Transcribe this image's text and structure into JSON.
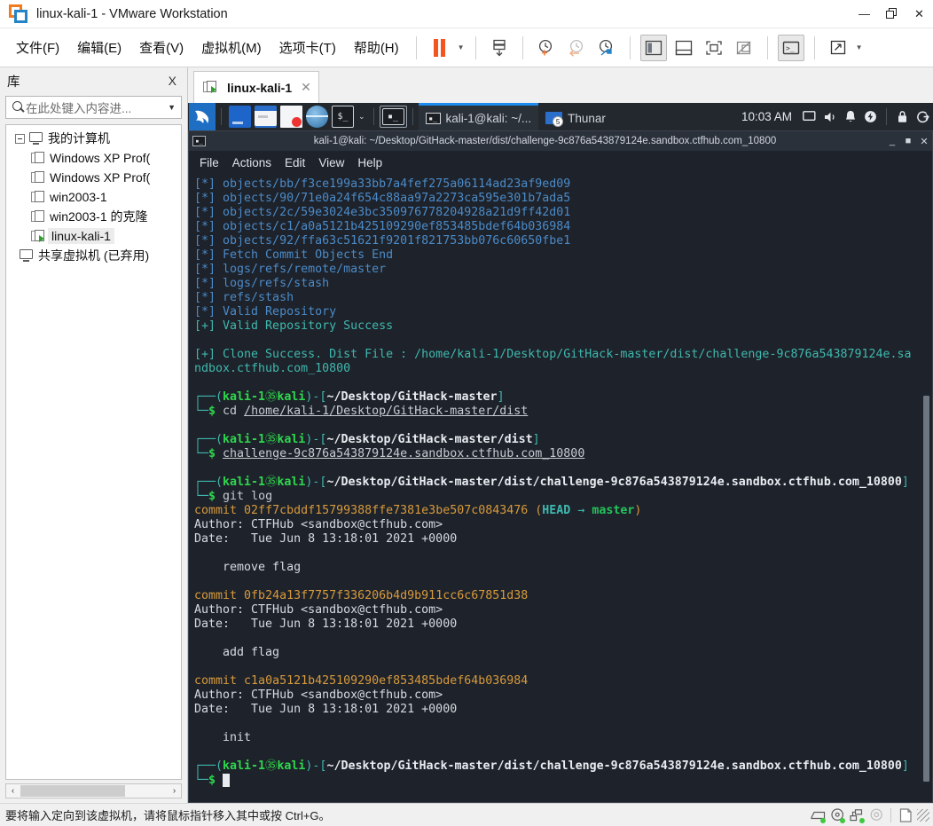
{
  "window": {
    "title": "linux-kali-1 - VMware Workstation",
    "logo_icon": "vmware-logo-icon",
    "controls": {
      "minimize": "—",
      "restore": "❐",
      "close": "✕"
    }
  },
  "menubar": {
    "items": [
      {
        "label": "文件(F)",
        "accel": "F",
        "name": "menu-file"
      },
      {
        "label": "编辑(E)",
        "accel": "E",
        "name": "menu-edit"
      },
      {
        "label": "查看(V)",
        "accel": "V",
        "name": "menu-view"
      },
      {
        "label": "虚拟机(M)",
        "accel": "M",
        "name": "menu-vm"
      },
      {
        "label": "选项卡(T)",
        "accel": "T",
        "name": "menu-tabs"
      },
      {
        "label": "帮助(H)",
        "accel": "H",
        "name": "menu-help"
      }
    ],
    "toolbar_icons": [
      "pause-icon",
      "dropdown-caret-icon",
      "snapshot-icon",
      "take-snapshot-icon",
      "revert-snapshot-icon",
      "snapshot-manager-icon",
      "show-library-icon",
      "show-thumbnails-icon",
      "fullscreen-icon",
      "unity-mode-icon",
      "console-view-icon",
      "stretch-guest-icon"
    ],
    "accent_orange": "#f4541d"
  },
  "sidebar": {
    "title": "库",
    "close_label": "X",
    "search": {
      "placeholder": "在此处键入内容进...",
      "value": "",
      "icon": "search-icon",
      "caret": "▼"
    },
    "tree": {
      "root": {
        "label": "我的计算机",
        "icon": "computer-icon",
        "expanded": true
      },
      "items": [
        {
          "label": "Windows XP Prof(",
          "icon": "vm-icon",
          "selected": false,
          "clone": false
        },
        {
          "label": "Windows XP Prof(",
          "icon": "vm-clone-icon",
          "selected": false,
          "clone": true
        },
        {
          "label": "win2003-1",
          "icon": "vm-icon",
          "selected": false,
          "clone": false
        },
        {
          "label": "win2003-1 的克隆",
          "icon": "vm-clone-icon",
          "selected": false,
          "clone": true
        },
        {
          "label": "linux-kali-1",
          "icon": "vm-running-icon",
          "selected": true,
          "clone": false,
          "running": true
        }
      ],
      "shared": {
        "label": "共享虚拟机 (已弃用)",
        "icon": "shared-vm-icon"
      }
    },
    "hscrollbar": {
      "left_arrow": "‹",
      "right_arrow": "›"
    }
  },
  "tabs": [
    {
      "label": "linux-kali-1",
      "icon": "vm-running-icon",
      "close": "✕",
      "active": true
    }
  ],
  "guest": {
    "panel": {
      "menu_icon": "kali-dragon-icon",
      "launchers": [
        "show-desktop-icon",
        "file-manager-icon",
        "text-editor-icon",
        "web-browser-icon",
        "terminal-icon"
      ],
      "launcher_caret": "⌄",
      "active_launcher": "terminal-icon",
      "tasks": [
        {
          "label": "kali-1@kali: ~/...",
          "icon": "terminal-icon",
          "active": true
        },
        {
          "label": "Thunar",
          "icon": "folder-icon",
          "badge": "5",
          "active": false
        }
      ],
      "clock": "10:03 AM",
      "tray_icons": [
        "display-icon",
        "volume-icon",
        "notification-bell-icon",
        "power-icon",
        "lock-icon",
        "logout-icon"
      ]
    },
    "terminal": {
      "icon": "terminal-icon",
      "title": "kali-1@kali: ~/Desktop/GitHack-master/dist/challenge-9c876a543879124e.sandbox.ctfhub.com_10800",
      "controls": {
        "minimize": "_",
        "maximize": "■",
        "close": "✕"
      },
      "menu": [
        "File",
        "Actions",
        "Edit",
        "View",
        "Help"
      ],
      "colors": {
        "background": "#1e222a",
        "blue": "#4b8bc8",
        "cyan": "#3fb8af",
        "green": "#2fd64f",
        "yellow": "#d79a3c",
        "foreground": "#d6dbe1"
      },
      "gitfetch_lines": [
        "[*] objects/bb/f3ce199a33bb7a4fef275a06114ad23af9ed09",
        "[*] objects/90/71e0a24f654c88aa97a2273ca595e301b7ada5",
        "[*] objects/2c/59e3024e3bc350976778204928a21d9ff42d01",
        "[*] objects/c1/a0a5121b425109290ef853485bdef64b036984",
        "[*] objects/92/ffa63c51621f9201f821753bb076c60650fbe1",
        "[*] Fetch Commit Objects End",
        "[*] logs/refs/remote/master",
        "[*] logs/refs/stash",
        "[*] refs/stash",
        "[*] Valid Repository"
      ],
      "success_line": "[+] Valid Repository Success",
      "clone_line_1": "[+] Clone Success. Dist File : /home/kali-1/Desktop/GitHack-master/dist/challenge-9c876a543879124e.sa",
      "clone_line_2": "ndbox.ctfhub.com_10800",
      "prompts": [
        {
          "user": "kali-1",
          "host": "kali",
          "sep": "㉟",
          "path": "~/Desktop/GitHack-master",
          "command": "cd ",
          "argument": "/home/kali-1/Desktop/GitHack-master/dist"
        },
        {
          "user": "kali-1",
          "host": "kali",
          "sep": "㉟",
          "path": "~/Desktop/GitHack-master/dist",
          "command": "",
          "argument": "challenge-9c876a543879124e.sandbox.ctfhub.com_10800"
        },
        {
          "user": "kali-1",
          "host": "kali",
          "sep": "㉟",
          "path": "~/Desktop/GitHack-master/dist/challenge-9c876a543879124e.sandbox.ctfhub.com_10800",
          "command": "git log",
          "argument": ""
        },
        {
          "user": "kali-1",
          "host": "kali",
          "sep": "㉟",
          "path": "~/Desktop/GitHack-master/dist/challenge-9c876a543879124e.sandbox.ctfhub.com_10800",
          "command": "",
          "argument": "",
          "cursor": true
        }
      ],
      "git_log": [
        {
          "commit_word": "commit ",
          "hash": "02ff7cbddf15799388ffe7381e3be507c0843476",
          "refs_open": " (",
          "head": "HEAD",
          "arrow": " → ",
          "branch": "master",
          "refs_close": ")",
          "author": "Author: CTFHub <sandbox@ctfhub.com>",
          "date": "Date:   Tue Jun 8 13:18:01 2021 +0000",
          "message": "    remove flag"
        },
        {
          "commit_word": "commit ",
          "hash": "0fb24a13f7757f336206b4d9b911cc6c67851d38",
          "refs_open": "",
          "head": "",
          "arrow": "",
          "branch": "",
          "refs_close": "",
          "author": "Author: CTFHub <sandbox@ctfhub.com>",
          "date": "Date:   Tue Jun 8 13:18:01 2021 +0000",
          "message": "    add flag"
        },
        {
          "commit_word": "commit ",
          "hash": "c1a0a5121b425109290ef853485bdef64b036984",
          "refs_open": "",
          "head": "",
          "arrow": "",
          "branch": "",
          "refs_close": "",
          "author": "Author: CTFHub <sandbox@ctfhub.com>",
          "date": "Date:   Tue Jun 8 13:18:01 2021 +0000",
          "message": "    init"
        }
      ]
    }
  },
  "statusbar": {
    "message": "要将输入定向到该虚拟机，请将鼠标指针移入其中或按 Ctrl+G。",
    "icons": [
      "hard-disk-icon",
      "cd-drive-icon",
      "network-adapter-icon",
      "sound-card-icon",
      "snapshot-doc-icon",
      "resize-grip-icon"
    ]
  }
}
